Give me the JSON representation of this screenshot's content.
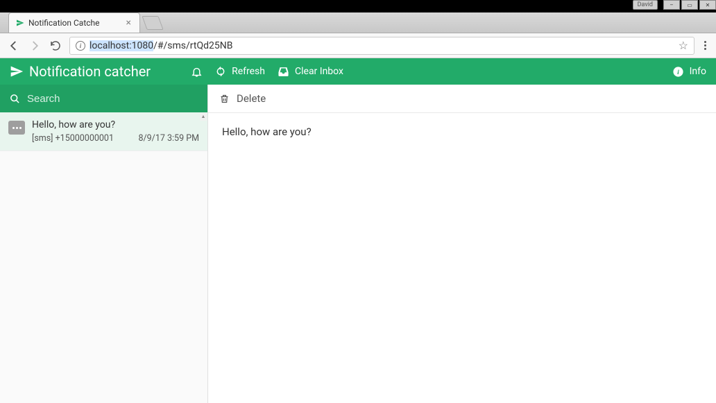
{
  "os": {
    "user": "David"
  },
  "browser": {
    "tab_title": "Notification Catche",
    "url_host": "localhost:1080",
    "url_path": "/#/sms/rtQd25NB"
  },
  "header": {
    "app_name": "Notification catcher",
    "refresh": "Refresh",
    "clear": "Clear Inbox",
    "info": "Info"
  },
  "search": {
    "placeholder": "Search"
  },
  "messages": [
    {
      "subject": "Hello, how are you?",
      "from": "[sms] +15000000001",
      "date": "8/9/17 3:59 PM"
    }
  ],
  "detail": {
    "delete": "Delete",
    "body": "Hello, how are you?"
  }
}
